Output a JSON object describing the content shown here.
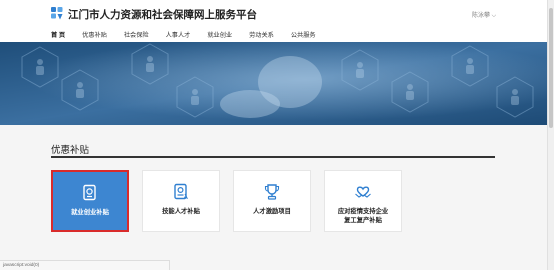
{
  "header": {
    "site_title": "江门市人力资源和社会保障网上服务平台",
    "user_menu": "陈泳攀 ⌵"
  },
  "nav": {
    "items": [
      "首 页",
      "优惠补贴",
      "社会保险",
      "人事人才",
      "就业创业",
      "劳动关系",
      "公共服务"
    ]
  },
  "section": {
    "title": "优惠补贴"
  },
  "cards": [
    {
      "line1": "就业创业补贴",
      "line2": "",
      "icon": "document-seal-icon"
    },
    {
      "line1": "技能人才补贴",
      "line2": "",
      "icon": "certificate-icon"
    },
    {
      "line1": "人才激励项目",
      "line2": "",
      "icon": "trophy-icon"
    },
    {
      "line1": "应对疫情支持企业",
      "line2": "复工复产补贴",
      "icon": "handshake-heart-icon"
    }
  ],
  "statusbar": {
    "text": "javascript:void(0)"
  },
  "colors": {
    "brand_blue": "#3d86d1",
    "highlight_red": "#d92b2b",
    "banner_navy": "#2c5a86"
  }
}
